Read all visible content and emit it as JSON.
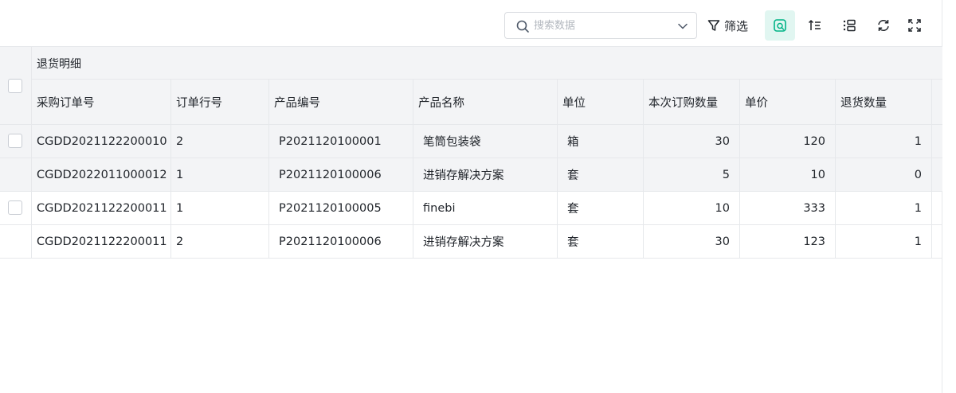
{
  "toolbar": {
    "search": {
      "placeholder": "搜索数据",
      "value": ""
    },
    "filter_label": "筛选",
    "buttons": [
      {
        "name": "view-toggle",
        "icon": "table-view-icon",
        "active": true
      },
      {
        "name": "sort",
        "icon": "sort-icon"
      },
      {
        "name": "group",
        "icon": "group-list-icon"
      },
      {
        "name": "refresh",
        "icon": "refresh-icon"
      },
      {
        "name": "fullscreen",
        "icon": "fullscreen-icon"
      }
    ],
    "accent_color": "#00b386"
  },
  "table": {
    "group_title": "退货明细",
    "columns": [
      "采购订单号",
      "订单行号",
      "产品编号",
      "产品名称",
      "单位",
      "本次订购数量",
      "单价",
      "退货数量"
    ],
    "rows": [
      [
        "CGDD2021122200010",
        "2",
        "P2021120100001",
        "笔筒包装袋",
        "箱",
        "30",
        "120",
        "1"
      ],
      [
        "CGDD2022011000012",
        "1",
        "P2021120100006",
        "进销存解决方案",
        "套",
        "5",
        "10",
        "0"
      ],
      [
        "CGDD2021122200011",
        "1",
        "P2021120100005",
        "finebi",
        "套",
        "10",
        "333",
        "1"
      ],
      [
        "CGDD2021122200011",
        "2",
        "P2021120100006",
        "进销存解决方案",
        "套",
        "30",
        "123",
        "1"
      ]
    ]
  }
}
